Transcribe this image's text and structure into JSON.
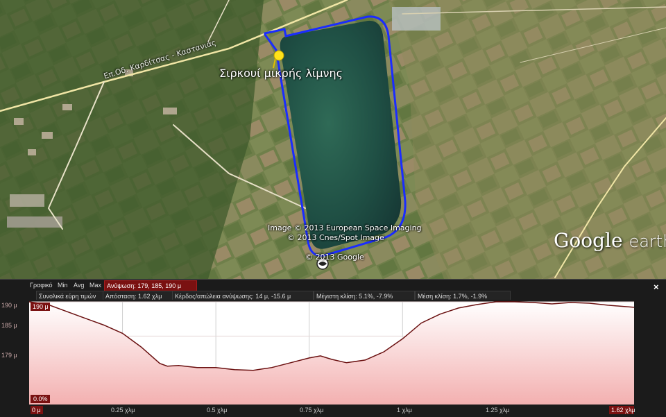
{
  "map": {
    "track_name": "Σιρκουί μικρής λίμνης",
    "road_name": "Επ.Οδ. Καρδίτσας - Καστανιάς",
    "credits": [
      "Image © 2013 European Space Imaging",
      "© 2013 Cnes/Spot Image",
      "© 2013 Google"
    ],
    "brand": "Google",
    "brand_suffix": "earth",
    "track_color": "#1a2cff",
    "water_color": "#1f4f44",
    "pin_color": "#ffe21a"
  },
  "profile": {
    "row1": {
      "graph_label": "Γραφικό",
      "min_label": "Min",
      "avg_label": "Avg",
      "max_label": "Max",
      "elevation_label": "Ανύψωση: 179, 185, 190 μ"
    },
    "row2": {
      "range_label": "Συνολικά εύρη τιμών",
      "distance": "Απόσταση: 1.62 χλμ",
      "gain_loss": "Κέρδος/απώλεια ανύψωσης: 14 μ, -15.6 μ",
      "max_slope": "Μέγιστη κλίση: 5.1%, -7.9%",
      "avg_slope": "Μέση κλίση: 1.7%, -1.9%"
    },
    "y_axis_labels": [
      "190 μ",
      "185 μ",
      "179 μ"
    ],
    "x_axis_labels": [
      "0 μ",
      "0.25 χλμ",
      "0.5 χλμ",
      "0.75 χλμ",
      "1 χλμ",
      "1.25 χλμ",
      "1.62 χλμ"
    ],
    "top_tag": "190 μ",
    "bottom_tag": "0.0%",
    "close_symbol": "×"
  },
  "chart_data": {
    "type": "area",
    "xlabel": "",
    "ylabel": "",
    "x_unit": "km",
    "xlim": [
      0,
      1.62
    ],
    "ylim": [
      175,
      190
    ],
    "x": [
      0,
      0.05,
      0.1,
      0.15,
      0.2,
      0.25,
      0.3,
      0.35,
      0.37,
      0.4,
      0.45,
      0.5,
      0.55,
      0.6,
      0.65,
      0.7,
      0.75,
      0.78,
      0.81,
      0.85,
      0.9,
      0.95,
      1.0,
      1.05,
      1.1,
      1.15,
      1.2,
      1.25,
      1.3,
      1.35,
      1.4,
      1.45,
      1.5,
      1.55,
      1.62
    ],
    "series": [
      {
        "values": [
          190,
          189.6,
          188.6,
          187.6,
          186.6,
          185.4,
          183.4,
          181.0,
          180.6,
          180.7,
          180.4,
          180.4,
          180.1,
          180.0,
          180.4,
          181.1,
          181.8,
          182.1,
          181.6,
          181.1,
          181.5,
          182.7,
          184.6,
          186.9,
          188.2,
          189.1,
          189.6,
          190.0,
          190.0,
          189.9,
          189.7,
          189.9,
          189.8,
          189.5,
          189.2
        ]
      }
    ],
    "grid": true
  }
}
